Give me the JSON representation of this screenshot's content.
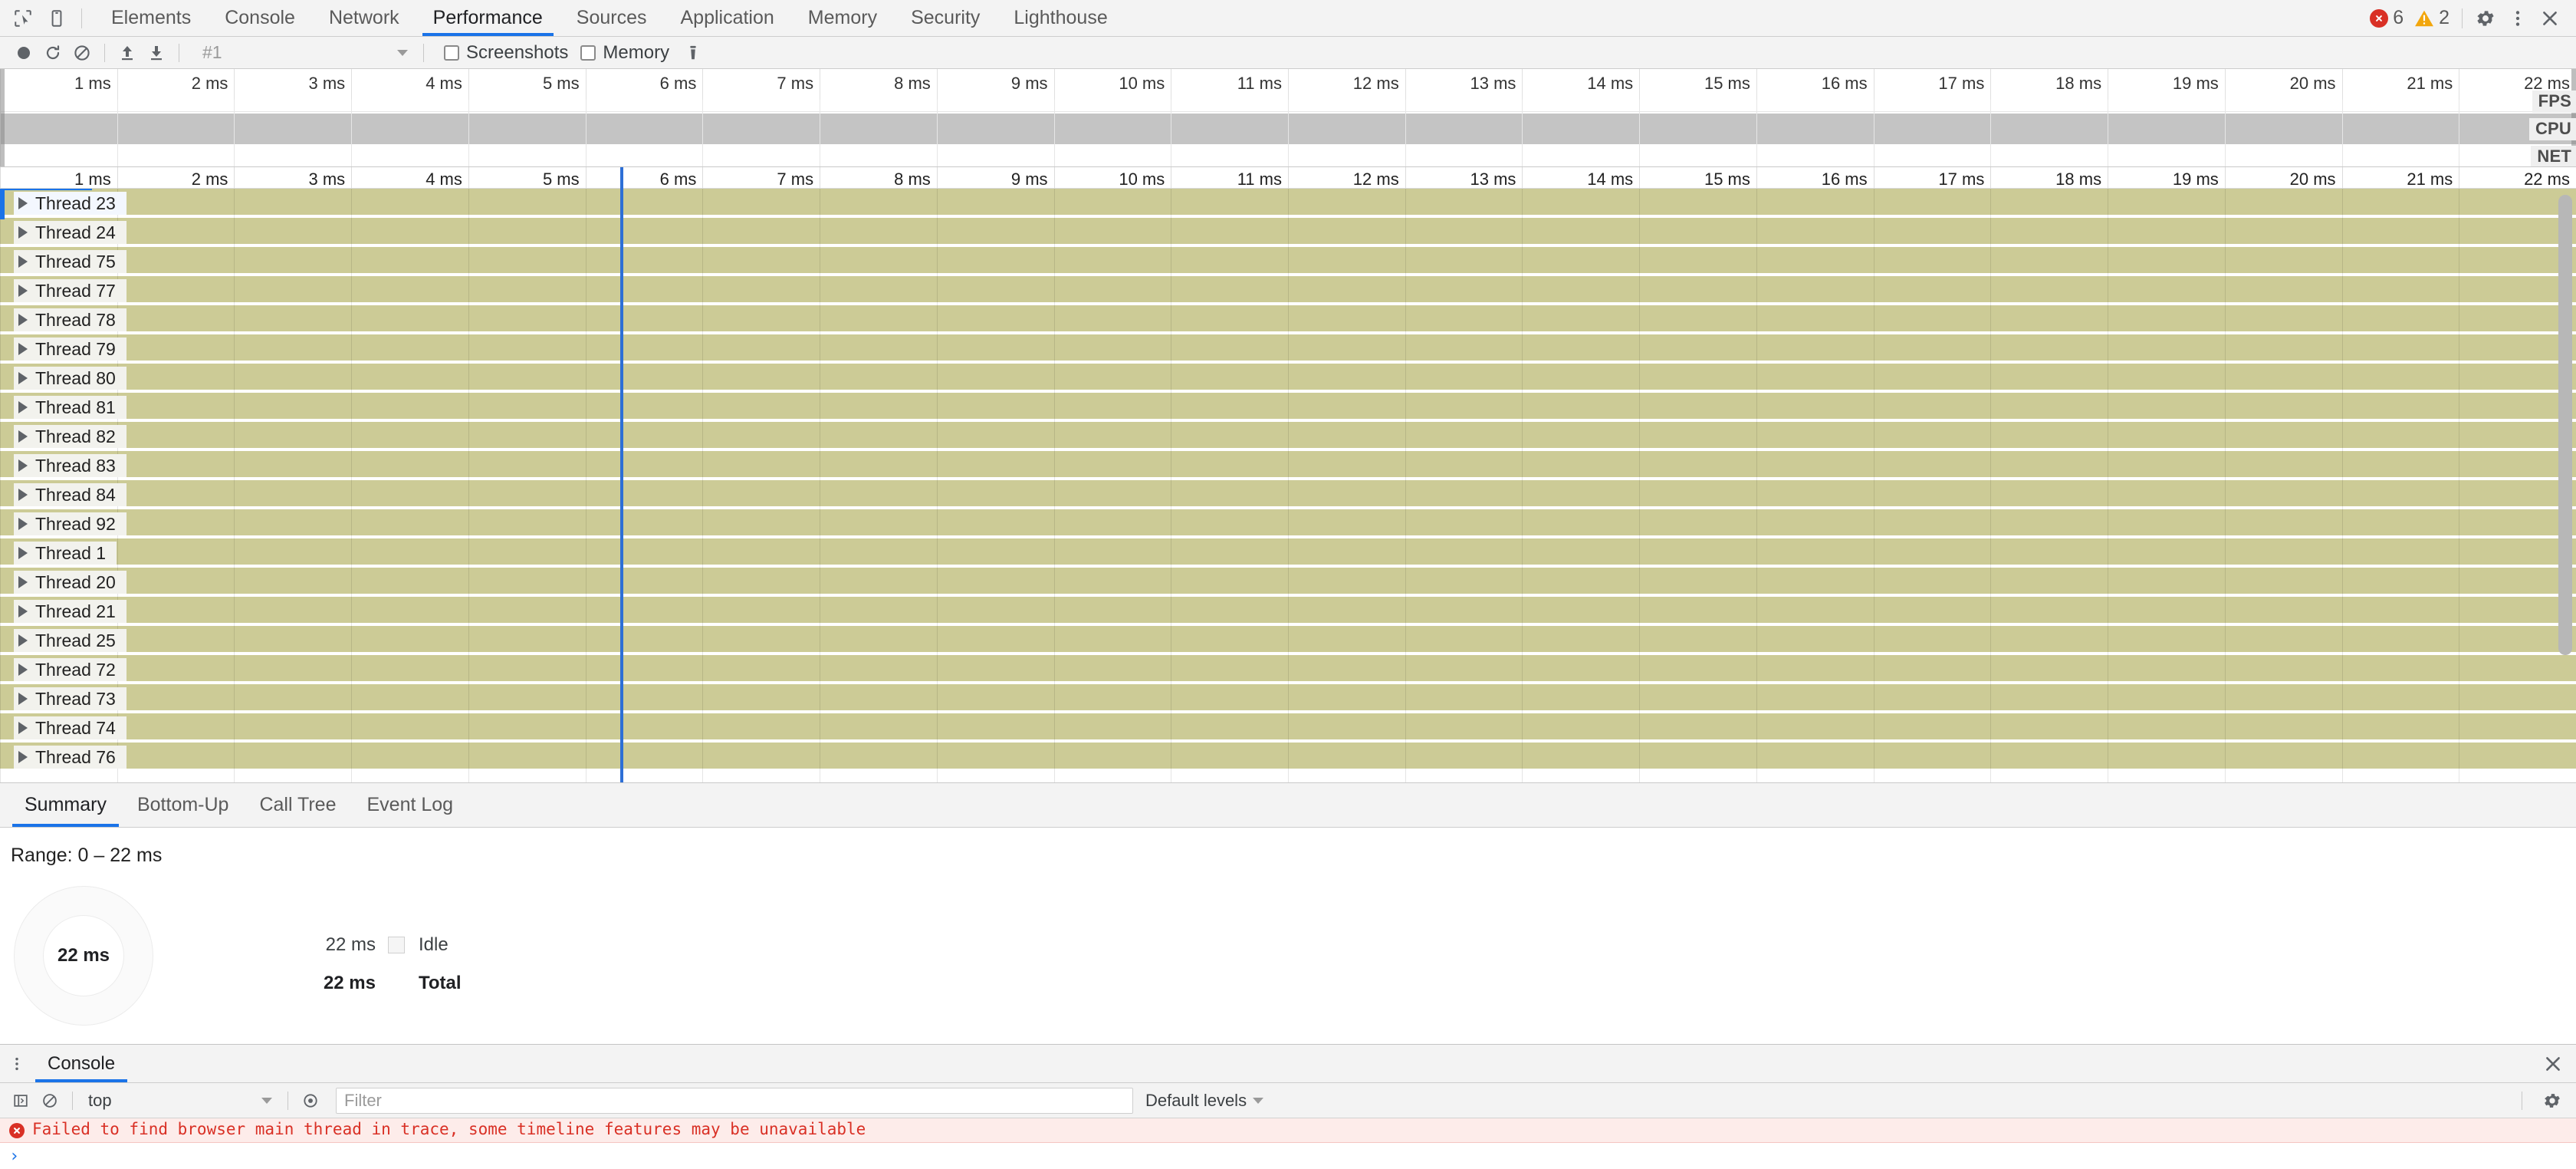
{
  "main_tabs": [
    {
      "label": "Elements",
      "active": false
    },
    {
      "label": "Console",
      "active": false
    },
    {
      "label": "Network",
      "active": false
    },
    {
      "label": "Performance",
      "active": true
    },
    {
      "label": "Sources",
      "active": false
    },
    {
      "label": "Application",
      "active": false
    },
    {
      "label": "Memory",
      "active": false
    },
    {
      "label": "Security",
      "active": false
    },
    {
      "label": "Lighthouse",
      "active": false
    }
  ],
  "status_badges": {
    "error_count": "6",
    "warning_count": "2"
  },
  "perf_toolbar": {
    "history_value": "#1",
    "screenshots_label": "Screenshots",
    "memory_label": "Memory",
    "screenshots_checked": false,
    "memory_checked": false
  },
  "overview": {
    "side_labels": [
      "FPS",
      "CPU",
      "NET"
    ],
    "ticks": [
      "1 ms",
      "2 ms",
      "3 ms",
      "4 ms",
      "5 ms",
      "6 ms",
      "7 ms",
      "8 ms",
      "9 ms",
      "10 ms",
      "11 ms",
      "12 ms",
      "13 ms",
      "14 ms",
      "15 ms",
      "16 ms",
      "17 ms",
      "18 ms",
      "19 ms",
      "20 ms",
      "21 ms",
      "22 ms"
    ]
  },
  "flamechart": {
    "ticks": [
      "1 ms",
      "2 ms",
      "3 ms",
      "4 ms",
      "5 ms",
      "6 ms",
      "7 ms",
      "8 ms",
      "9 ms",
      "10 ms",
      "11 ms",
      "12 ms",
      "13 ms",
      "14 ms",
      "15 ms",
      "16 ms",
      "17 ms",
      "18 ms",
      "19 ms",
      "20 ms",
      "21 ms",
      "22 ms"
    ],
    "marker_time_ms": 5.3,
    "track_color": "#cccb96",
    "tracks": [
      {
        "label": "Thread 23",
        "selected": true
      },
      {
        "label": "Thread 24",
        "selected": false
      },
      {
        "label": "Thread 75",
        "selected": false
      },
      {
        "label": "Thread 77",
        "selected": false
      },
      {
        "label": "Thread 78",
        "selected": false
      },
      {
        "label": "Thread 79",
        "selected": false
      },
      {
        "label": "Thread 80",
        "selected": false
      },
      {
        "label": "Thread 81",
        "selected": false
      },
      {
        "label": "Thread 82",
        "selected": false
      },
      {
        "label": "Thread 83",
        "selected": false
      },
      {
        "label": "Thread 84",
        "selected": false
      },
      {
        "label": "Thread 92",
        "selected": false
      },
      {
        "label": "Thread 1",
        "selected": false
      },
      {
        "label": "Thread 20",
        "selected": false
      },
      {
        "label": "Thread 21",
        "selected": false
      },
      {
        "label": "Thread 25",
        "selected": false
      },
      {
        "label": "Thread 72",
        "selected": false
      },
      {
        "label": "Thread 73",
        "selected": false
      },
      {
        "label": "Thread 74",
        "selected": false
      },
      {
        "label": "Thread 76",
        "selected": false
      }
    ]
  },
  "details": {
    "tabs": [
      {
        "label": "Summary",
        "active": true
      },
      {
        "label": "Bottom-Up",
        "active": false
      },
      {
        "label": "Call Tree",
        "active": false
      },
      {
        "label": "Event Log",
        "active": false
      }
    ],
    "range_text": "Range: 0 – 22 ms",
    "donut_center": "22 ms",
    "legend": [
      {
        "value": "22 ms",
        "name": "Idle",
        "swatch": true,
        "total": false
      },
      {
        "value": "22 ms",
        "name": "Total",
        "swatch": false,
        "total": true
      }
    ]
  },
  "drawer": {
    "tab_label": "Console",
    "context_value": "top",
    "filter_placeholder": "Filter",
    "levels_label": "Default levels",
    "messages": [
      {
        "type": "error",
        "text": "Failed to find browser main thread in trace, some timeline features may be unavailable"
      }
    ],
    "prompt": "›"
  },
  "colors": {
    "accent": "#1a73e8",
    "error": "#d93025",
    "warning": "#f2a60c",
    "track": "#cccb96",
    "cpu_band": "#c4c4c4",
    "toolbar_bg": "#f3f3f3"
  }
}
